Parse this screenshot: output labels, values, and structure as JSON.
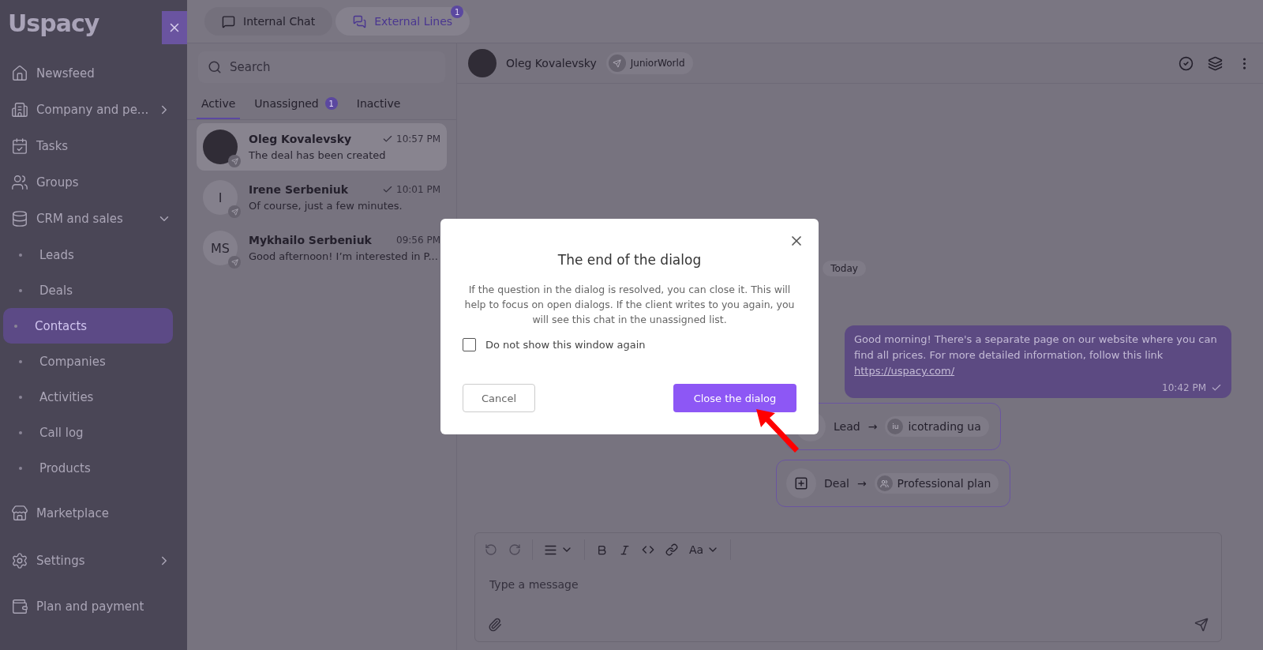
{
  "sidebar": {
    "logo": "Uspacy",
    "items": [
      {
        "label": "Newsfeed",
        "selected": false,
        "has_submenu": false
      },
      {
        "label": "Company and pe...",
        "selected": false,
        "has_submenu": true
      },
      {
        "label": "Tasks",
        "selected": false,
        "has_submenu": false
      },
      {
        "label": "Groups",
        "selected": false,
        "has_submenu": false
      },
      {
        "label": "CRM and sales",
        "selected": false,
        "has_submenu": false,
        "expanded": true,
        "children": [
          {
            "label": "Leads",
            "selected": false
          },
          {
            "label": "Deals",
            "selected": false
          },
          {
            "label": "Contacts",
            "selected": true
          },
          {
            "label": "Companies",
            "selected": false
          },
          {
            "label": "Activities",
            "selected": false
          },
          {
            "label": "Call log",
            "selected": false
          },
          {
            "label": "Products",
            "selected": false
          }
        ]
      },
      {
        "label": "Marketplace",
        "selected": false,
        "has_submenu": false
      },
      {
        "label": "Settings",
        "selected": false,
        "has_submenu": true
      },
      {
        "label": "Plan and payment",
        "selected": false,
        "has_submenu": false
      }
    ]
  },
  "top_tabs": [
    {
      "label": "Internal Chat",
      "selected": false
    },
    {
      "label": "External Lines",
      "selected": true,
      "badge": "1"
    }
  ],
  "chat_list": {
    "search": {
      "placeholder": "Search"
    },
    "filter_tabs": [
      {
        "label": "Active",
        "selected": true
      },
      {
        "label": "Unassigned",
        "selected": false,
        "badge": "1"
      },
      {
        "label": "Inactive",
        "selected": false
      }
    ],
    "chats": [
      {
        "name": "Oleg Kovalevsky",
        "time": "10:57 PM",
        "message": "The deal has been created",
        "read": true,
        "selected": true
      },
      {
        "name": "Irene Serbeniuk",
        "time": "10:01 PM",
        "message": "Of course, just a few minutes.",
        "read": true,
        "selected": false,
        "initials": "I"
      },
      {
        "name": "Mykhailo Serbeniuk",
        "time": "09:56 PM",
        "message": "Good afternoon! I’m interested in P...",
        "read": false,
        "selected": false,
        "initials": "MS"
      }
    ]
  },
  "chat": {
    "header": {
      "name": "Oleg Kovalevsky",
      "channel": "JuniorWorld"
    },
    "date_divider": "Today",
    "message": {
      "text": "Good morning! There's a separate page on our website where you can find all prices. For more detailed information, follow this link",
      "link": "https://uspacy.com/",
      "time": "10:42 PM",
      "read": true
    },
    "events": [
      {
        "kind": "lead",
        "label": "Lead",
        "arrow": "→",
        "target": "icotrading ua",
        "target_initials": "iu"
      },
      {
        "kind": "deal",
        "label": "Deal",
        "arrow": "→",
        "target": "Professional plan"
      }
    ],
    "composer": {
      "placeholder": "Type a message",
      "font_button": "Aa"
    }
  },
  "modal": {
    "title": "The end of the dialog",
    "body": "If the question in the dialog is resolved, you can close it. This will help to focus on open dialogs. If the client writes to you again, you will see this chat in the unassigned list.",
    "checkbox": {
      "label": "Do not show this window again",
      "checked": false
    },
    "cancel": "Cancel",
    "confirm": "Close the dialog"
  }
}
